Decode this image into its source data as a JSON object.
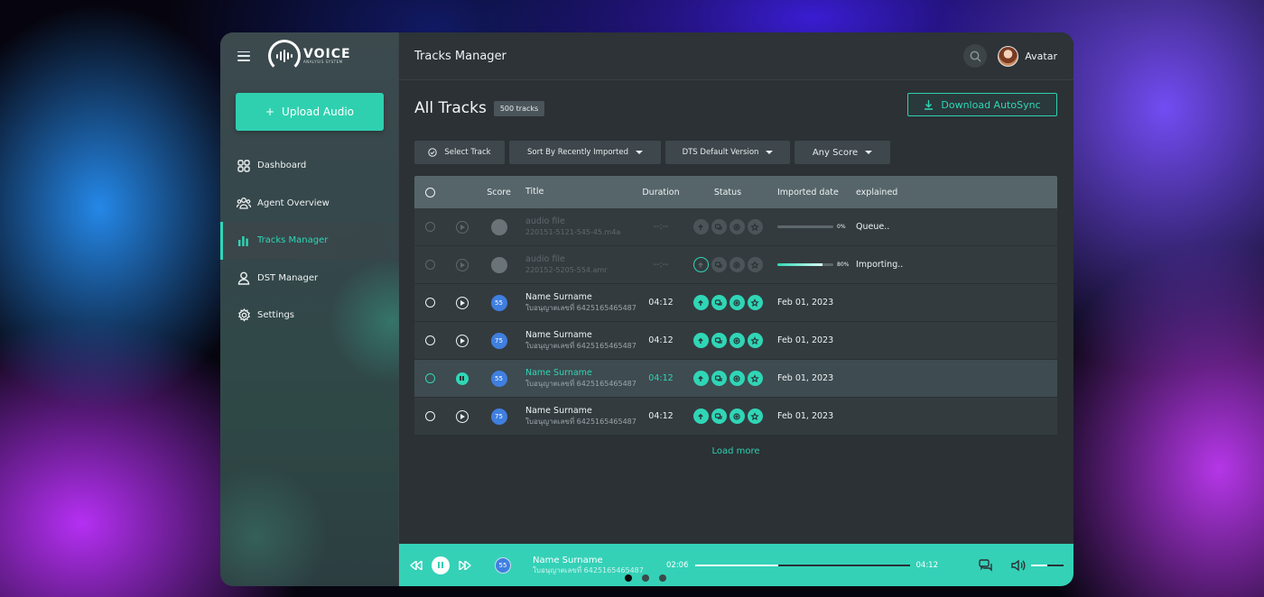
{
  "sidebar": {
    "logo": {
      "title": "VOICE",
      "subtitle": "ANALYSIS SYSTEM"
    },
    "upload_label": "Upload Audio",
    "items": [
      {
        "label": "Dashboard",
        "icon": "dashboard-icon"
      },
      {
        "label": "Agent Overview",
        "icon": "people-icon"
      },
      {
        "label": "Tracks Manager",
        "icon": "bars-chart-icon",
        "active": true
      },
      {
        "label": "DST Manager",
        "icon": "user-icon"
      },
      {
        "label": "Settings",
        "icon": "gear-icon"
      }
    ]
  },
  "header": {
    "title": "Tracks Manager",
    "user_name": "Avatar"
  },
  "main": {
    "heading": "All Tracks",
    "count_badge": "500 tracks",
    "download_label": "Download AutoSync",
    "filters": {
      "select": "Select Track",
      "sort": "Sort By Recently Imported",
      "version": "DTS Default Version",
      "score": "Any Score"
    },
    "columns": {
      "score": "Score",
      "title": "Title",
      "duration": "Duration",
      "status": "Status",
      "imported": "Imported date",
      "explained": "explained"
    },
    "rows": [
      {
        "title": "audio file",
        "subtitle": "220151-5121-545-45.m4a",
        "duration": "--:--",
        "progress_label": "0%",
        "progress": 0,
        "explained": "Queue.."
      },
      {
        "title": "audio file",
        "subtitle": "220152-5205-554.amr",
        "duration": "--:--",
        "progress_label": "80%",
        "progress": 0.8,
        "explained": "Importing.."
      },
      {
        "score": "55",
        "title": "Name Surname",
        "subtitle": "ใบอนุญาตเลขที่ 6425165465487",
        "duration": "04:12",
        "date": "Feb 01, 2023"
      },
      {
        "score": "75",
        "title": "Name Surname",
        "subtitle": "ใบอนุญาตเลขที่ 6425165465487",
        "duration": "04:12",
        "date": "Feb 01, 2023"
      },
      {
        "score": "55",
        "title": "Name Surname",
        "subtitle": "ใบอนุญาตเลขที่ 6425165465487",
        "duration": "04:12",
        "date": "Feb 01, 2023"
      },
      {
        "score": "75",
        "title": "Name Surname",
        "subtitle": "ใบอนุญาตเลขที่ 6425165465487",
        "duration": "04:12",
        "date": "Feb 01, 2023"
      }
    ],
    "load_more": "Load more"
  },
  "player": {
    "score": "55",
    "name": "Name Surname",
    "subtitle": "ใบอนุญาตเลขที่ 6425165465487",
    "current_time": "02:06",
    "total_time": "04:12",
    "progress": 0.39,
    "volume": 0.5
  },
  "colors": {
    "accent": "#2fd6b6",
    "score_badge": "#3f7fe0"
  }
}
